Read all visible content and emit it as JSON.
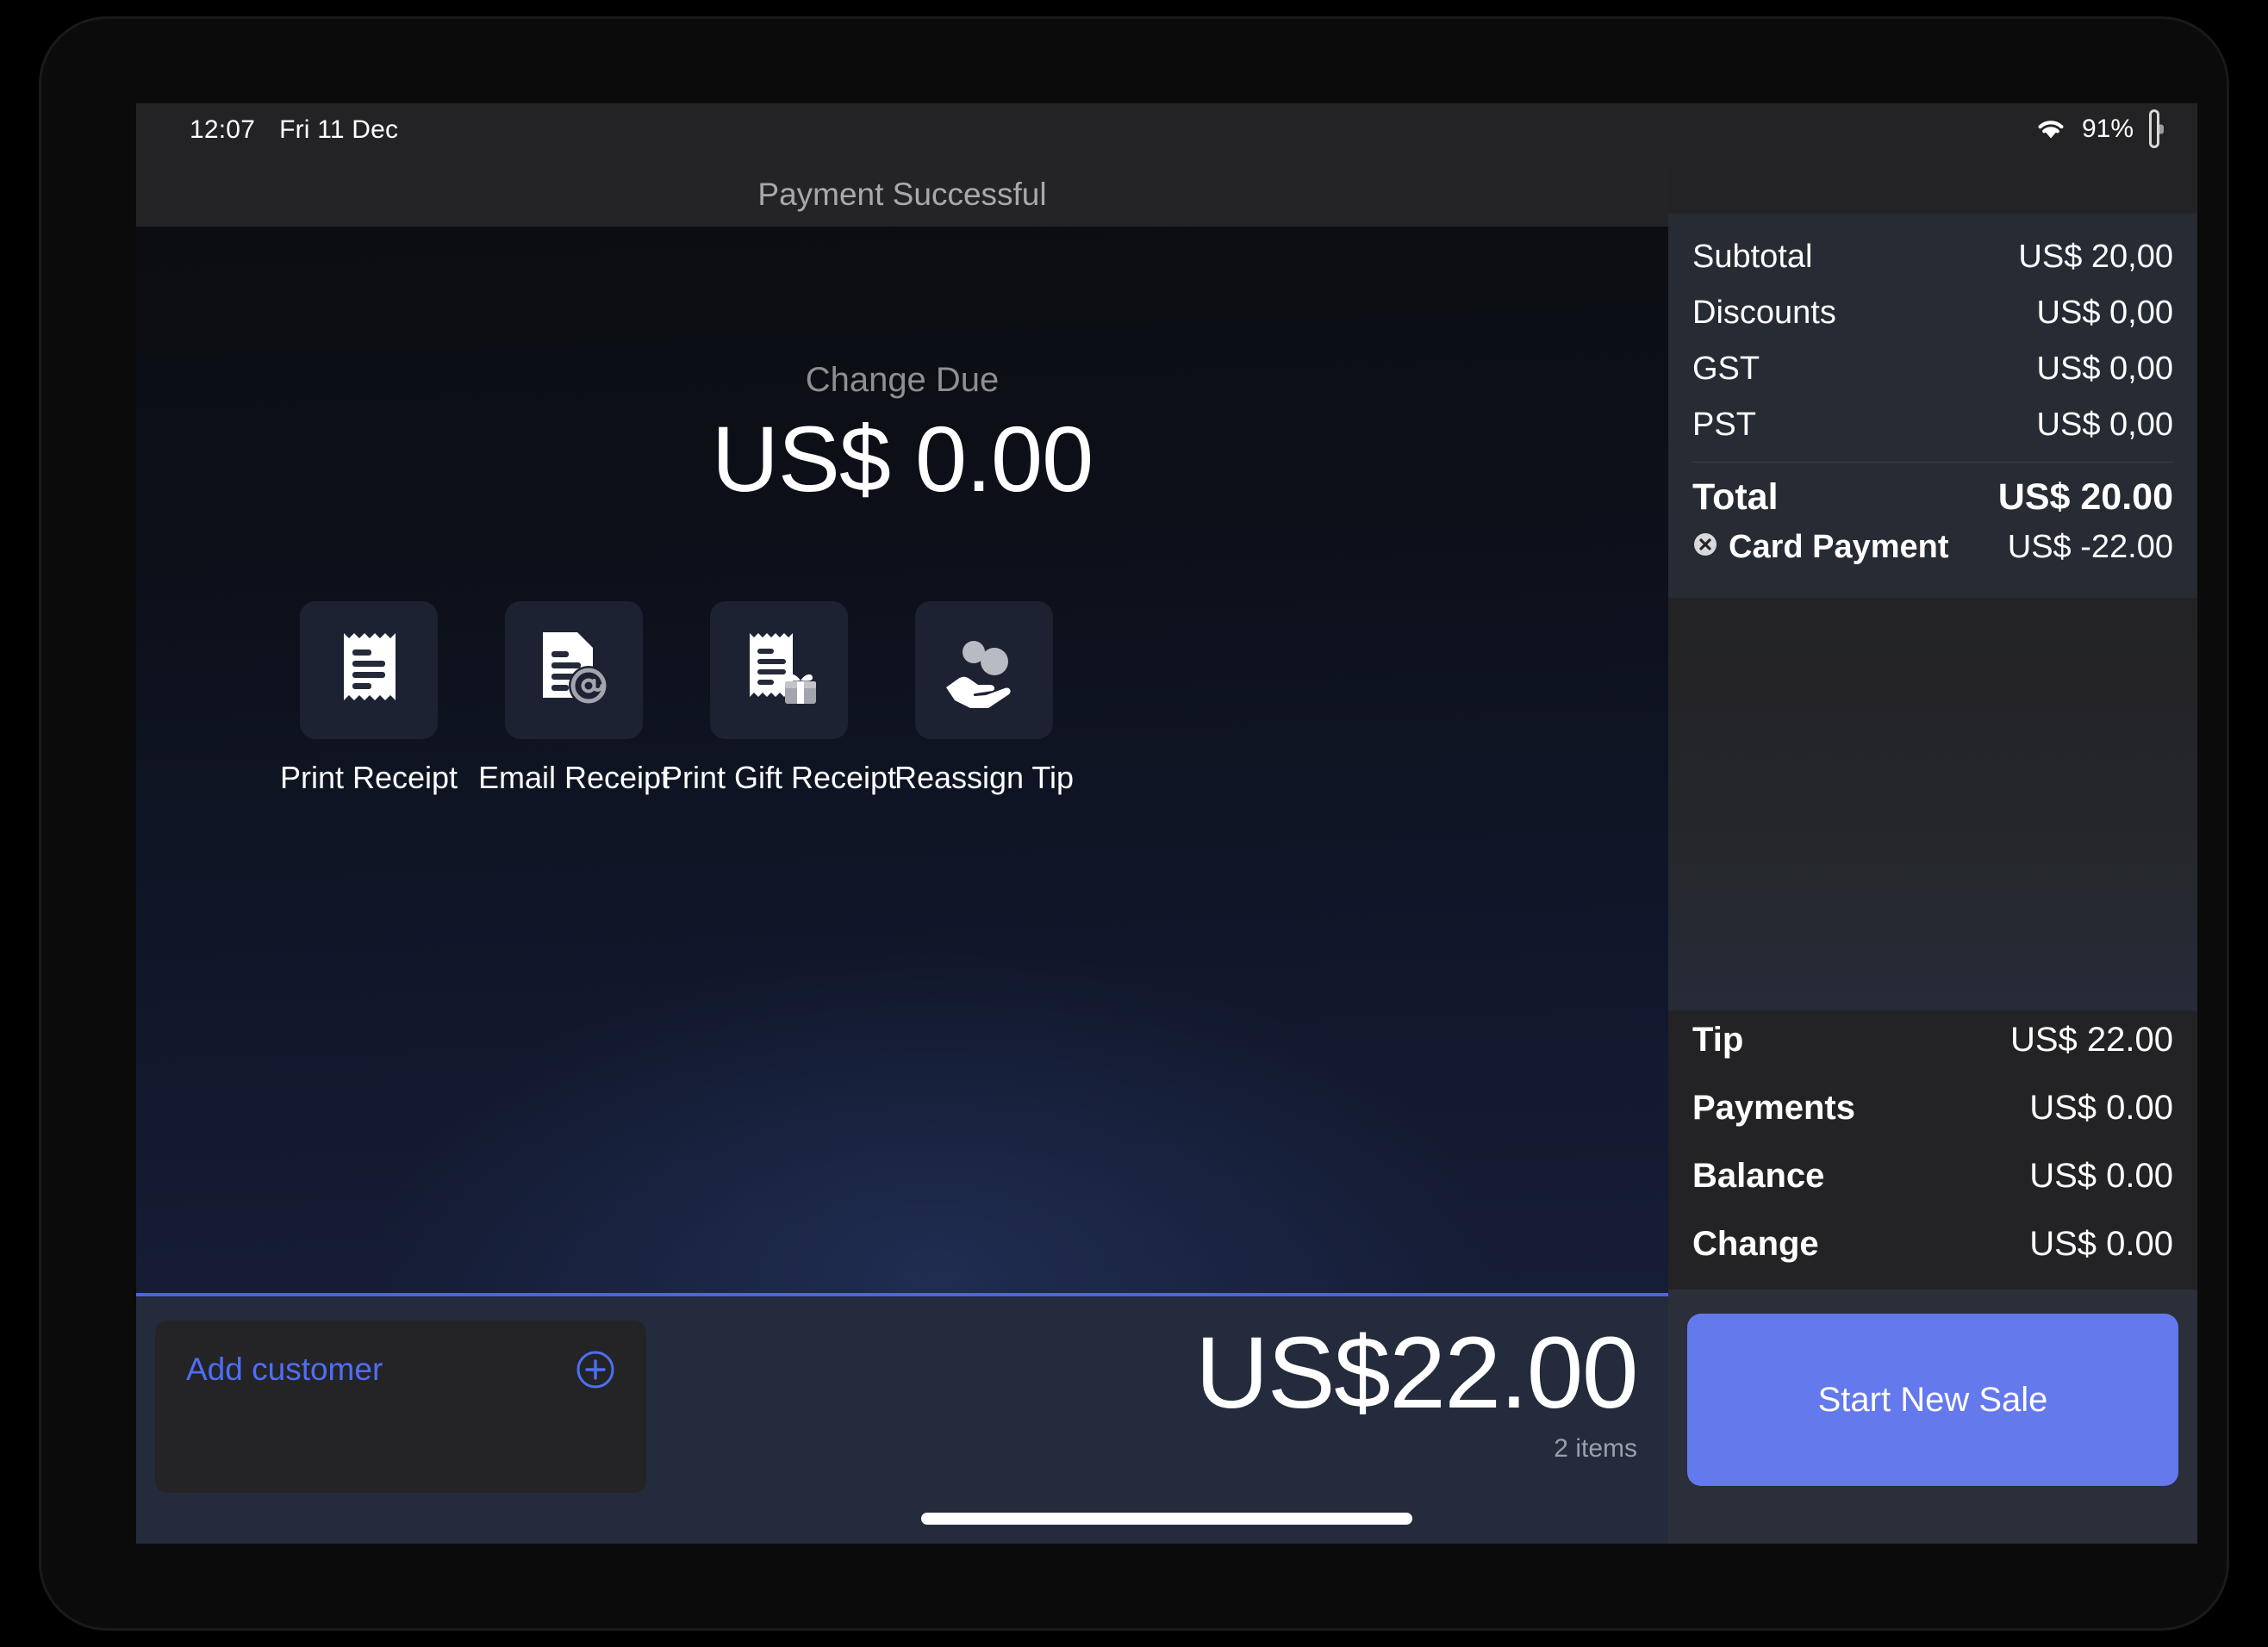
{
  "status_bar": {
    "time": "12:07",
    "date": "Fri 11 Dec",
    "battery_percent": "91%",
    "wifi_icon": "wifi-icon",
    "battery_icon": "battery-icon"
  },
  "header": {
    "title": "Payment Successful"
  },
  "change_due": {
    "label": "Change Due",
    "value": "US$ 0.00"
  },
  "actions": [
    {
      "label": "Print Receipt",
      "icon": "receipt-icon"
    },
    {
      "label": "Email Receipt",
      "icon": "document-at-icon"
    },
    {
      "label": "Print Gift Receipt",
      "icon": "receipt-gift-icon"
    },
    {
      "label": "Reassign Tip",
      "icon": "hand-coins-icon"
    }
  ],
  "bottom_bar": {
    "add_customer_label": "Add customer",
    "add_customer_icon": "plus-circle-icon",
    "grand_total": "US$22.00",
    "items_count": "2 items"
  },
  "summary": {
    "rows": [
      {
        "label": "Subtotal",
        "value": "US$ 20,00"
      },
      {
        "label": "Discounts",
        "value": "US$ 0,00"
      },
      {
        "label": "GST",
        "value": "US$ 0,00"
      },
      {
        "label": "PST",
        "value": "US$ 0,00"
      }
    ],
    "total": {
      "label": "Total",
      "value": "US$ 20.00"
    },
    "payment": {
      "label": "Card Payment",
      "value": "US$ -22.00",
      "icon": "remove-circle-icon"
    }
  },
  "totals": [
    {
      "label": "Tip",
      "value": "US$ 22.00"
    },
    {
      "label": "Payments",
      "value": "US$ 0.00"
    },
    {
      "label": "Balance",
      "value": "US$ 0.00"
    },
    {
      "label": "Change",
      "value": "US$ 0.00"
    }
  ],
  "panel_footer": {
    "start_new_sale_label": "Start New Sale"
  },
  "colors": {
    "accent_blue": "#6479ec",
    "link_blue": "#4f6ef5",
    "panel_bg": "#272b33",
    "tile_bg": "#1d2233"
  }
}
